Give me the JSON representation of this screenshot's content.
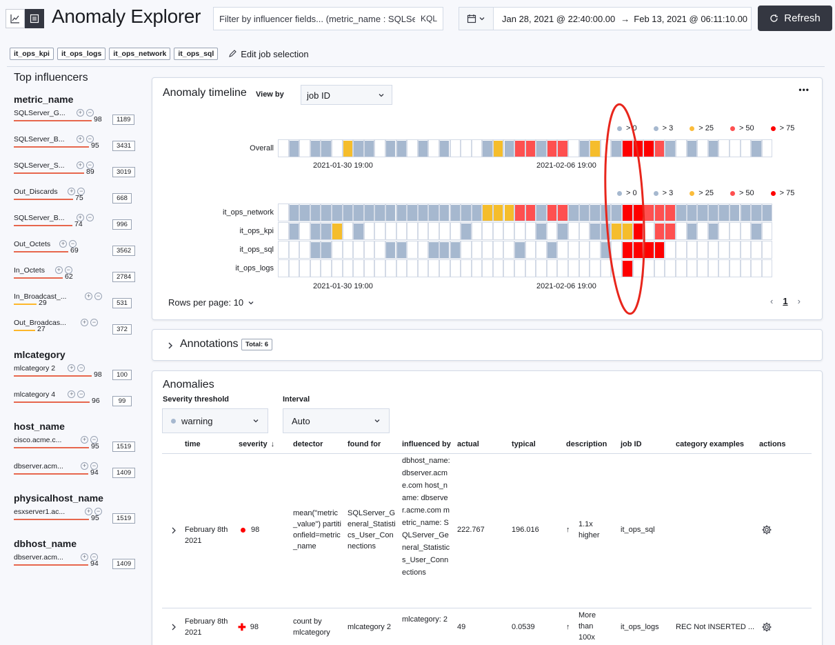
{
  "header": {
    "title": "Anomaly Explorer",
    "kql_placeholder": "Filter by influencer fields... (metric_name : SQLServer",
    "kql_label": "KQL",
    "date_from": "Jan 28, 2021 @ 22:40:00.00",
    "date_arrow": "→",
    "date_to": "Feb 13, 2021 @ 06:11:10.00",
    "refresh_label": "Refresh"
  },
  "jobs": {
    "badges": [
      "it_ops_kpi",
      "it_ops_logs",
      "it_ops_network",
      "it_ops_sql"
    ],
    "edit_label": "Edit job selection"
  },
  "influencers": {
    "title": "Top influencers",
    "groups": [
      {
        "name": "metric_name",
        "items": [
          {
            "label": "SQLServer_G...",
            "score": 98,
            "count": 1189,
            "color": "#e7664c",
            "score_pct": 98
          },
          {
            "label": "SQLServer_B...",
            "score": 95,
            "count": 3431,
            "color": "#e7664c",
            "score_pct": 95
          },
          {
            "label": "SQLServer_S...",
            "score": 89,
            "count": 3019,
            "color": "#e7664c",
            "score_pct": 89
          },
          {
            "label": "Out_Discards",
            "score": 75,
            "count": 668,
            "color": "#e7664c",
            "score_pct": 75
          },
          {
            "label": "SQLServer_B...",
            "score": 74,
            "count": 996,
            "color": "#e7664c",
            "score_pct": 74
          },
          {
            "label": "Out_Octets",
            "score": 69,
            "count": 3562,
            "color": "#e7664c",
            "score_pct": 69
          },
          {
            "label": "In_Octets",
            "score": 62,
            "count": 2784,
            "color": "#e7664c",
            "score_pct": 62
          },
          {
            "label": "In_Broadcast_...",
            "score": 29,
            "count": 531,
            "color": "#fdb72a",
            "score_pct": 29
          },
          {
            "label": "Out_Broadcas...",
            "score": 27,
            "count": 372,
            "color": "#fdb72a",
            "score_pct": 27
          }
        ]
      },
      {
        "name": "mlcategory",
        "items": [
          {
            "label": "mlcategory 2",
            "score": 98,
            "count": 100,
            "color": "#e7664c",
            "score_pct": 98
          },
          {
            "label": "mlcategory 4",
            "score": 96,
            "count": 99,
            "color": "#e7664c",
            "score_pct": 96
          }
        ]
      },
      {
        "name": "host_name",
        "items": [
          {
            "label": "cisco.acme.c...",
            "score": 95,
            "count": 1519,
            "color": "#e7664c",
            "score_pct": 95
          },
          {
            "label": "dbserver.acm...",
            "score": 94,
            "count": 1409,
            "color": "#e7664c",
            "score_pct": 94
          }
        ]
      },
      {
        "name": "physicalhost_name",
        "items": [
          {
            "label": "esxserver1.ac...",
            "score": 95,
            "count": 1519,
            "color": "#e7664c",
            "score_pct": 95
          }
        ]
      },
      {
        "name": "dbhost_name",
        "items": [
          {
            "label": "dbserver.acm...",
            "score": 94,
            "count": 1409,
            "color": "#e7664c",
            "score_pct": 94
          }
        ]
      }
    ]
  },
  "timeline": {
    "title": "Anomaly timeline",
    "view_by_label": "View by",
    "view_by_value": "job ID",
    "legend": [
      {
        "label": "> 0",
        "color": "#a6b8cf"
      },
      {
        "label": "> 3",
        "color": "#a6b8cf"
      },
      {
        "label": "> 25",
        "color": "#fbbc3b"
      },
      {
        "label": "> 50",
        "color": "#fe5050"
      },
      {
        "label": "> 75",
        "color": "#fe0000"
      }
    ],
    "overall_label": "Overall",
    "x_ticks": [
      "2021-01-30 19:00",
      "2021-02-06 19:00"
    ],
    "rows_per_page": "Rows per page: 10",
    "page": "1",
    "overall": "0b0bb0ybb0bb0b0b000bybrrbrr0by0bRRRrb0b0b000b0000",
    "lanes": [
      {
        "label": "it_ops_network",
        "cells": "0bbbbbbbbbbbbbbbbbbyyyrrbrrbbbbbRRrrrbbbbbbbbbbb"
      },
      {
        "label": "it_ops_kpi",
        "cells": "0b0bby0b000000000b000000b0b00bbyyR0rr0b0b000b000"
      },
      {
        "label": "it_ops_sql",
        "cells": "000bb00000bb00bbb00000b00b0000b0RRRR00000000000"
      },
      {
        "label": "it_ops_logs",
        "cells": "00000000000000000000000000000000R0000000000000"
      }
    ]
  },
  "annotations": {
    "title": "Annotations",
    "total": "Total: 6"
  },
  "anomalies": {
    "title": "Anomalies",
    "severity_label": "Severity threshold",
    "severity_value": "warning",
    "interval_label": "Interval",
    "interval_value": "Auto",
    "columns": [
      "time",
      "severity",
      "detector",
      "found for",
      "influenced by",
      "actual",
      "typical",
      "description",
      "job ID",
      "category examples",
      "actions"
    ],
    "rows": [
      {
        "time": "February 8th 2021",
        "severity": "98",
        "detector": "mean(\"metric_value\") partitionfield=metric_name",
        "found_for": "SQLServer_General_Statistics_User_Connections",
        "influenced_by": "dbhost_name: dbserver.acme.com  host_name: dbserver.acme.com  metric_name: SQLServer_General_Statistics_User_Connections",
        "actual": "222.767",
        "typical": "196.016",
        "description": "1.1x higher",
        "job_id": "it_ops_sql",
        "category": ""
      },
      {
        "time": "February 8th 2021",
        "severity": "98",
        "detector": "count by mlcategory",
        "found_for": "mlcategory 2",
        "influenced_by": "mlcategory: 2",
        "actual": "49",
        "typical": "0.0539",
        "description": "More than 100x higher",
        "job_id": "it_ops_logs",
        "category": "REC Not INSERTED ..."
      }
    ]
  }
}
